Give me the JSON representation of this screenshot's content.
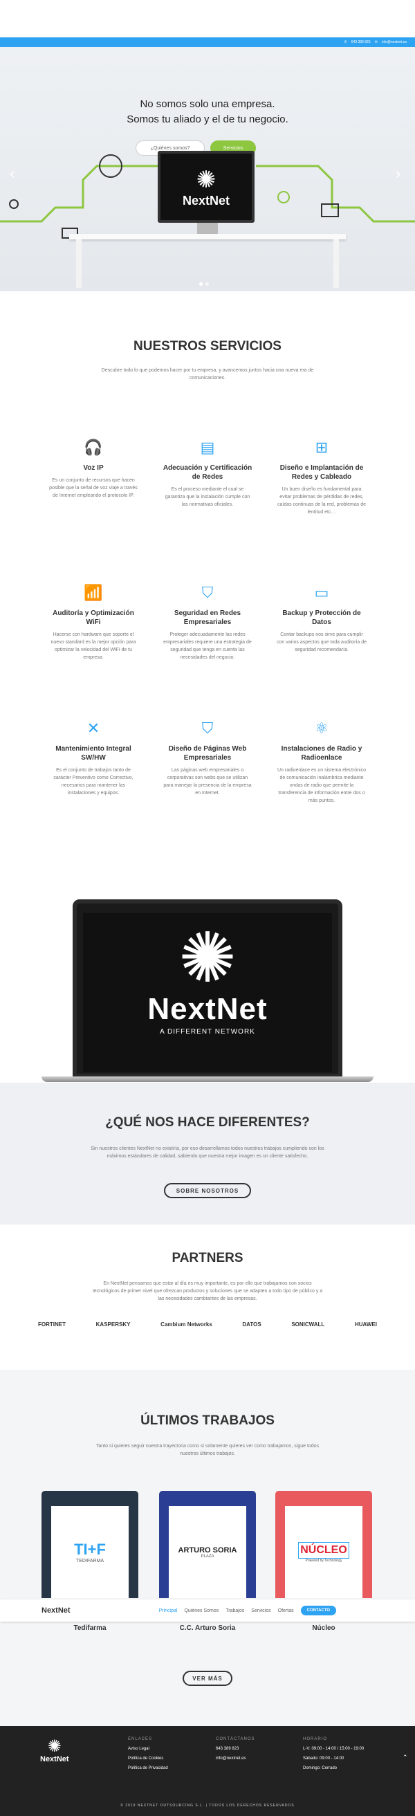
{
  "infobar": {
    "phone": "643 389 823",
    "email": "info@nextnet.es"
  },
  "hero": {
    "line1": "No somos solo una empresa.",
    "line2": "Somos tu aliado y el de tu negocio.",
    "btn_about": "¿Quiénes somos?",
    "btn_services": "Servicios",
    "monitor_text": "NextNet",
    "prev": "‹",
    "next": "›"
  },
  "services": {
    "title": "NUESTROS SERVICIOS",
    "desc": "Descubre todo lo que podemos hacer por tu empresa, y avancemos juntos hacia una nueva era de comunicaciones.",
    "items": [
      {
        "title": "Voz IP",
        "text": "Es un conjunto de recursos que hacen posible que la señal de voz viaje a través de Internet empleando el protocolo IP."
      },
      {
        "title": "Adecuación y Certificación de Redes",
        "text": "Es el proceso mediante el cual se garantiza que la instalación cumple con las normativas oficiales."
      },
      {
        "title": "Diseño e Implantación de Redes y Cableado",
        "text": "Un buen diseño es fundamental para evitar problemas de pérdidas de redes, caídas continuas de la red, problemas de lentitud etc…"
      },
      {
        "title": "Auditoría y Optimización WiFi",
        "text": "Hacerse con hardware que soporte el nuevo standard es la mejor opción para optimizar la velocidad del WiFi de tu empresa."
      },
      {
        "title": "Seguridad en Redes Empresariales",
        "text": "Proteger adecuadamente las redes empresariales requiere una estrategia de seguridad que tenga en cuenta las necesidades del negocio."
      },
      {
        "title": "Backup y Protección de Datos",
        "text": "Contar backups nos sirve para cumplir con varios aspectos que toda auditoría de seguridad recomendaría."
      },
      {
        "title": "Mantenimiento Integral SW/HW",
        "text": "Es el conjunto de trabajos tanto de carácter Preventivo como Correctivo, necesarios para mantener las instalaciones y equipos."
      },
      {
        "title": "Diseño de Páginas Web Empresariales",
        "text": "Las páginas web empresariales o corporativas son webs que se utilizan para manejar la presencia de la empresa en Internet."
      },
      {
        "title": "Instalaciones de Radio y Radioenlace",
        "text": "Un radioenlace es un sistema electrónico de comunicación inalámbrica mediante ondas de radio que permite la transferencia de información entre dos o más puntos."
      }
    ]
  },
  "laptop": {
    "brand": "NextNet",
    "tagline": "A DIFFERENT NETWORK"
  },
  "different": {
    "title": "¿QUÉ NOS HACE DIFERENTES?",
    "desc": "Sin nuestros clientes NextNet no existiría, por eso desarrollamos todos nuestros trabajos cumpliendo con los máximos estándares de calidad, sabiendo que nuestra mejor imagen es un cliente satisfecho.",
    "button": "SOBRE NOSOTROS"
  },
  "partners": {
    "title": "PARTNERS",
    "desc": "En NextNet pensamos que estar al día es muy importante, es por ello que trabajamos con socios tecnológicos de primer nivel que ofrezcan productos y soluciones que se adapten a todo tipo de público y a las necesidades cambiantes de las empresas.",
    "logos": [
      "FORTINET",
      "KASPERSKY",
      "Cambium Networks",
      "DATOS",
      "SONICWALL",
      "HUAWEI"
    ]
  },
  "works": {
    "title": "ÚLTIMOS TRABAJOS",
    "desc": "Tanto si quieres seguir nuestra trayectoria como si solamente quieres ver como trabajamos, sigue todos nuestros últimos trabajos.",
    "button": "VER MÁS",
    "items": [
      {
        "label": "Tedifarma",
        "logo": "TI+F",
        "sub": "TEDIFARMA",
        "color": "#263646"
      },
      {
        "label": "C.C. Arturo Soria",
        "logo": "ARTURO SORIA",
        "sub": "PLAZA",
        "color": "#2a3f93"
      },
      {
        "label": "Núcleo",
        "logo": "NÚCLEO",
        "sub": "Powered by Technology",
        "color": "#e85a5e"
      }
    ]
  },
  "nav": {
    "brand": "NextNet",
    "items": [
      "Principal",
      "Quiénes Somos",
      "Trabajos",
      "Servicios",
      "Ofertas"
    ],
    "cta": "CONTACTO"
  },
  "footer": {
    "brand": "NextNet",
    "enlaces_h": "ENLACES",
    "enlaces": [
      "Aviso Legal",
      "Política de Cookies",
      "Política de Privacidad"
    ],
    "contact_h": "CONTÁCTANOS",
    "phone": "643 389 823",
    "email": "info@nextnet.es",
    "horario_h": "HORARIO",
    "horario": [
      "L-V: 09:00 - 14:00 / 15:00 - 19:00",
      "Sábado: 09:00 - 14:00",
      "Domingo: Cerrado"
    ],
    "copyright": "© 2019 NEXTNET OUTSOURCING S.L. | TODOS LOS DERECHOS RESERVADOS"
  }
}
